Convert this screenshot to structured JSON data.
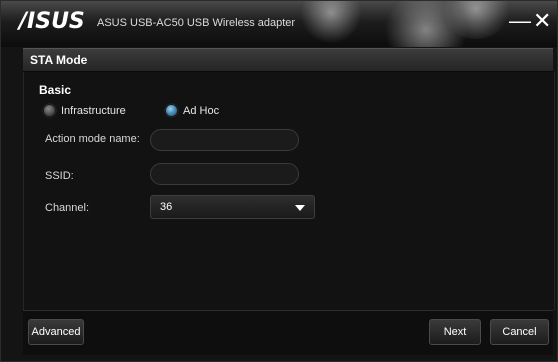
{
  "window": {
    "brand": "/ISUS",
    "title": "ASUS USB-AC50 USB Wireless adapter",
    "minimize_glyph": "—",
    "close_glyph": "✕"
  },
  "header": {
    "title": "STA Mode"
  },
  "basic": {
    "section_title": "Basic",
    "modes": [
      {
        "label": "Infrastructure",
        "selected": false
      },
      {
        "label": "Ad Hoc",
        "selected": true
      }
    ]
  },
  "fields": {
    "action_mode_name": {
      "label": "Action mode name:",
      "value": ""
    },
    "ssid": {
      "label": "SSID:",
      "value": ""
    },
    "channel": {
      "label": "Channel:",
      "value": "36"
    }
  },
  "footer": {
    "advanced_label": "Advanced",
    "next_label": "Next",
    "cancel_label": "Cancel"
  },
  "colors": {
    "background": "#141414",
    "radio_selected": "#4a8fb8",
    "text": "#ffffff"
  }
}
